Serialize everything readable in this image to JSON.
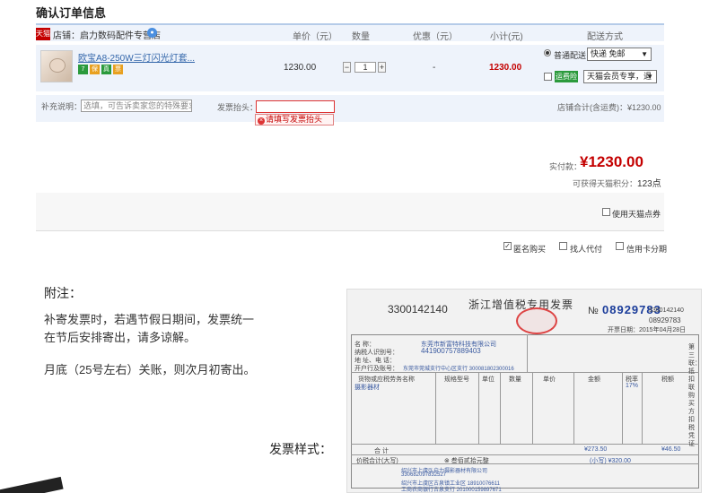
{
  "order": {
    "section_title": "确认订单信息",
    "shop_badge": "天猫",
    "shop_label": "店铺：启力数码配件专营店",
    "columns": {
      "unit_price": "单价（元）",
      "quantity": "数量",
      "discount": "优惠（元）",
      "subtotal": "小计(元)",
      "shipping": "配送方式"
    }
  },
  "item": {
    "title": "欧宝A8-250W三灯闪光灯套...",
    "price": "1230.00",
    "quantity": "1",
    "discount": "-",
    "subtotal": "1230.00",
    "tags": [
      {
        "label": "7",
        "color": "#2b9a3c"
      },
      {
        "label": "保",
        "color": "#e8a020"
      },
      {
        "label": "真",
        "color": "#2b9a3c"
      },
      {
        "label": "票",
        "color": "#e8a020"
      }
    ],
    "shipping_normal_label": "普通配送",
    "shipping_normal_value": "快递 免邮",
    "fast_ship_badge": "运费险",
    "fast_ship_value": "天猫会员专享，退"
  },
  "extra": {
    "remark_label": "补充说明：",
    "remark_placeholder": "选填，可告诉卖家您的特殊要求",
    "invoice_label": "发票抬头：",
    "invoice_value": "",
    "invoice_error": "请填写发票抬头",
    "shop_total": "店铺合计(含运费)：¥1230.00"
  },
  "total": {
    "paid_label": "实付款：",
    "paid_amount": "¥1230.00",
    "points_text": "可获得天猫积分：",
    "points_value": "123点",
    "use_points": "使用天猫点券",
    "anonymous": "匿名购买",
    "pay_for_me": "找人代付",
    "credit_installment": "信用卡分期"
  },
  "note": {
    "title": "附注：",
    "lines": [
      "补寄发票时，若遇节假日期间，发票统一",
      "在节后安排寄出，请多谅解。",
      "月底（25号左右）关账，则次月初寄出。"
    ],
    "sample_label": "发票样式："
  },
  "invoice_sample": {
    "code": "3300142140",
    "title": "浙江增值税专用发票",
    "no_label": "№",
    "number": "08929783",
    "small_no": "3300142140",
    "small_number": "08929783",
    "date_label": "开票日期：",
    "date": "2015年04月28日",
    "buyer_name_label": "名  称：",
    "buyer_name": "东莞市新富特科技有限公司",
    "tax_id_label": "纳税人识别号：",
    "tax_id": "441900757889403",
    "addr_label": "地 址、电 话：",
    "bank_label": "开户行及账号：",
    "bank": "东莞市莞城支行中心区支行 300081802300016",
    "goods_label": "货物或应税劳务名称",
    "spec_label": "规格型号",
    "unit_label": "单位",
    "qty_label": "数量",
    "unit_price_label": "单价",
    "amount_label": "金额",
    "rate_label": "税率",
    "tax_label": "税额",
    "goods": "摄影器材",
    "rate": "17%",
    "total_label": "合    计",
    "sum_amount": "¥273.50",
    "sum_tax": "¥46.50",
    "tax_total_label": "价税合计(大写)",
    "tax_total_cn": "⊗ 叁佰贰拾元整",
    "tax_total_small": "(小写) ¥320.00",
    "seller_name": "绍兴市上虞弘启力摄影器材有限公司",
    "seller_tax_id": "330682097832527",
    "seller_addr": "绍兴市上虞区古泉镇工业区 18910076611",
    "seller_bank": "工商农商银行古泉支行 201000159897671",
    "seller_side": "第三联：抵扣联 购买方扣税凭证"
  }
}
